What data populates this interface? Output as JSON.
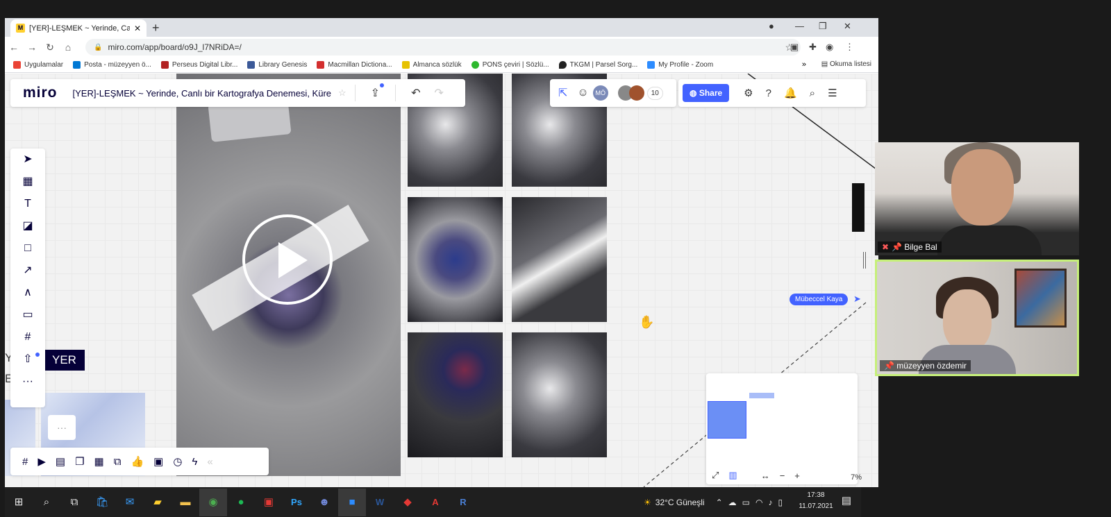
{
  "browser": {
    "tab_title": "[YER]-LEŞMEK ~ Yerinde, Canlı bir",
    "tab_favicon": "M",
    "url": "miro.com/app/board/o9J_l7NRiDA=/",
    "bookmarks": [
      {
        "label": "Uygulamalar",
        "color": "#ea4335"
      },
      {
        "label": "Posta - müzeyyen ö...",
        "color": "#0078d4"
      },
      {
        "label": "Perseus Digital Libr...",
        "color": "#b22222"
      },
      {
        "label": "Library Genesis",
        "color": "#3b5998"
      },
      {
        "label": "Macmillan Dictiona...",
        "color": "#d32f2f"
      },
      {
        "label": "Almanca sözlük",
        "color": "#e6c200"
      },
      {
        "label": "PONS çeviri | Sözlü...",
        "color": "#2eb82e"
      },
      {
        "label": "TKGM | Parsel Sorg...",
        "color": "#222222"
      },
      {
        "label": "My Profile - Zoom",
        "color": "#2d8cff"
      }
    ],
    "bookmarks_more": "»",
    "reading_list": "Okuma listesi"
  },
  "miro": {
    "logo": "miro",
    "board_name": "[YER]-LEŞMEK ~ Yerinde, Canlı bir Kartografya Denemesi, Küre",
    "avatar_initials": "MÖ",
    "collaborator_count": "10",
    "share_label": "Share",
    "frame_label": "YER",
    "frame_label_left": "Y",
    "frame_label_left2": "E",
    "cursor_name": "Mübeccel Kaya",
    "zoom_level": "7%",
    "accent": "#4262ff"
  },
  "taskbar": {
    "weather": "32°C  Güneşli",
    "time": "17:38",
    "date": "11.07.2021"
  },
  "zoom": {
    "participants": [
      {
        "name": "Bilge Bal",
        "muted": true
      },
      {
        "name": "müzeyyen özdemir",
        "muted": false
      }
    ],
    "active_border": "#c6f07a"
  }
}
